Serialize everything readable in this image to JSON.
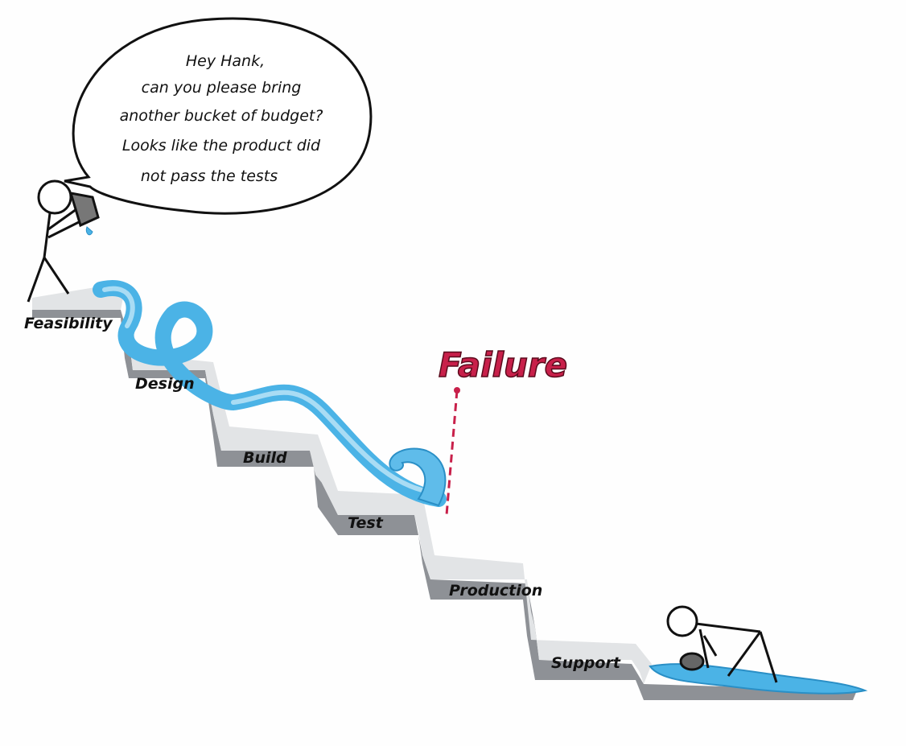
{
  "speech_bubble": {
    "lines": [
      "Hey Hank,",
      "can you please bring",
      "another bucket of budget?",
      "Looks like the product did",
      "not pass the tests"
    ]
  },
  "stages": [
    "Feasibility",
    "Design",
    "Build",
    "Test",
    "Production",
    "Support"
  ],
  "failure_label": "Failure",
  "colors": {
    "water": "#4bb3e6",
    "water_light": "#a9dcf4",
    "shadow": "#8e9196",
    "step": "#dfe1e3",
    "failure": "#c8204a"
  }
}
